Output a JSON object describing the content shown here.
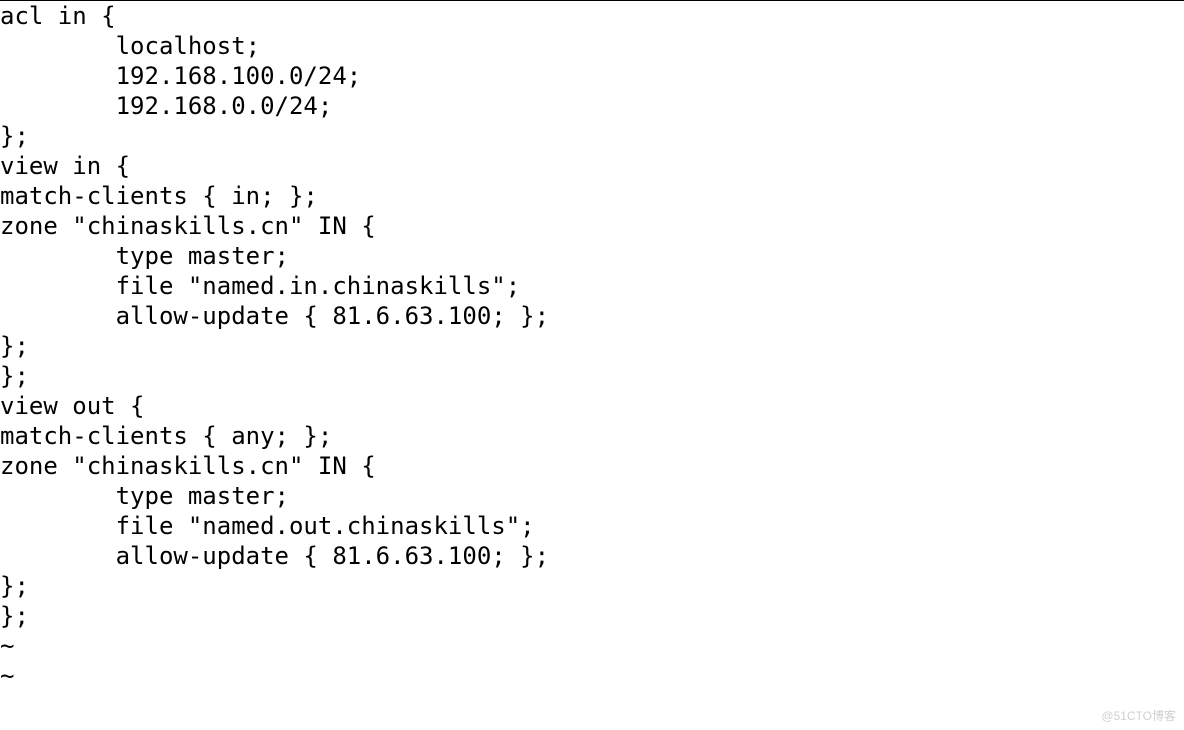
{
  "lines": [
    "acl in {",
    "        localhost;",
    "        192.168.100.0/24;",
    "        192.168.0.0/24;",
    "};",
    "view in {",
    "match-clients { in; };",
    "zone \"chinaskills.cn\" IN {",
    "        type master;",
    "        file \"named.in.chinaskills\";",
    "        allow-update { 81.6.63.100; };",
    "};",
    "};",
    "view out {",
    "match-clients { any; };",
    "zone \"chinaskills.cn\" IN {",
    "        type master;",
    "        file \"named.out.chinaskills\";",
    "        allow-update { 81.6.63.100; };",
    "};",
    "};",
    "~",
    "~"
  ],
  "watermark": "@51CTO博客"
}
